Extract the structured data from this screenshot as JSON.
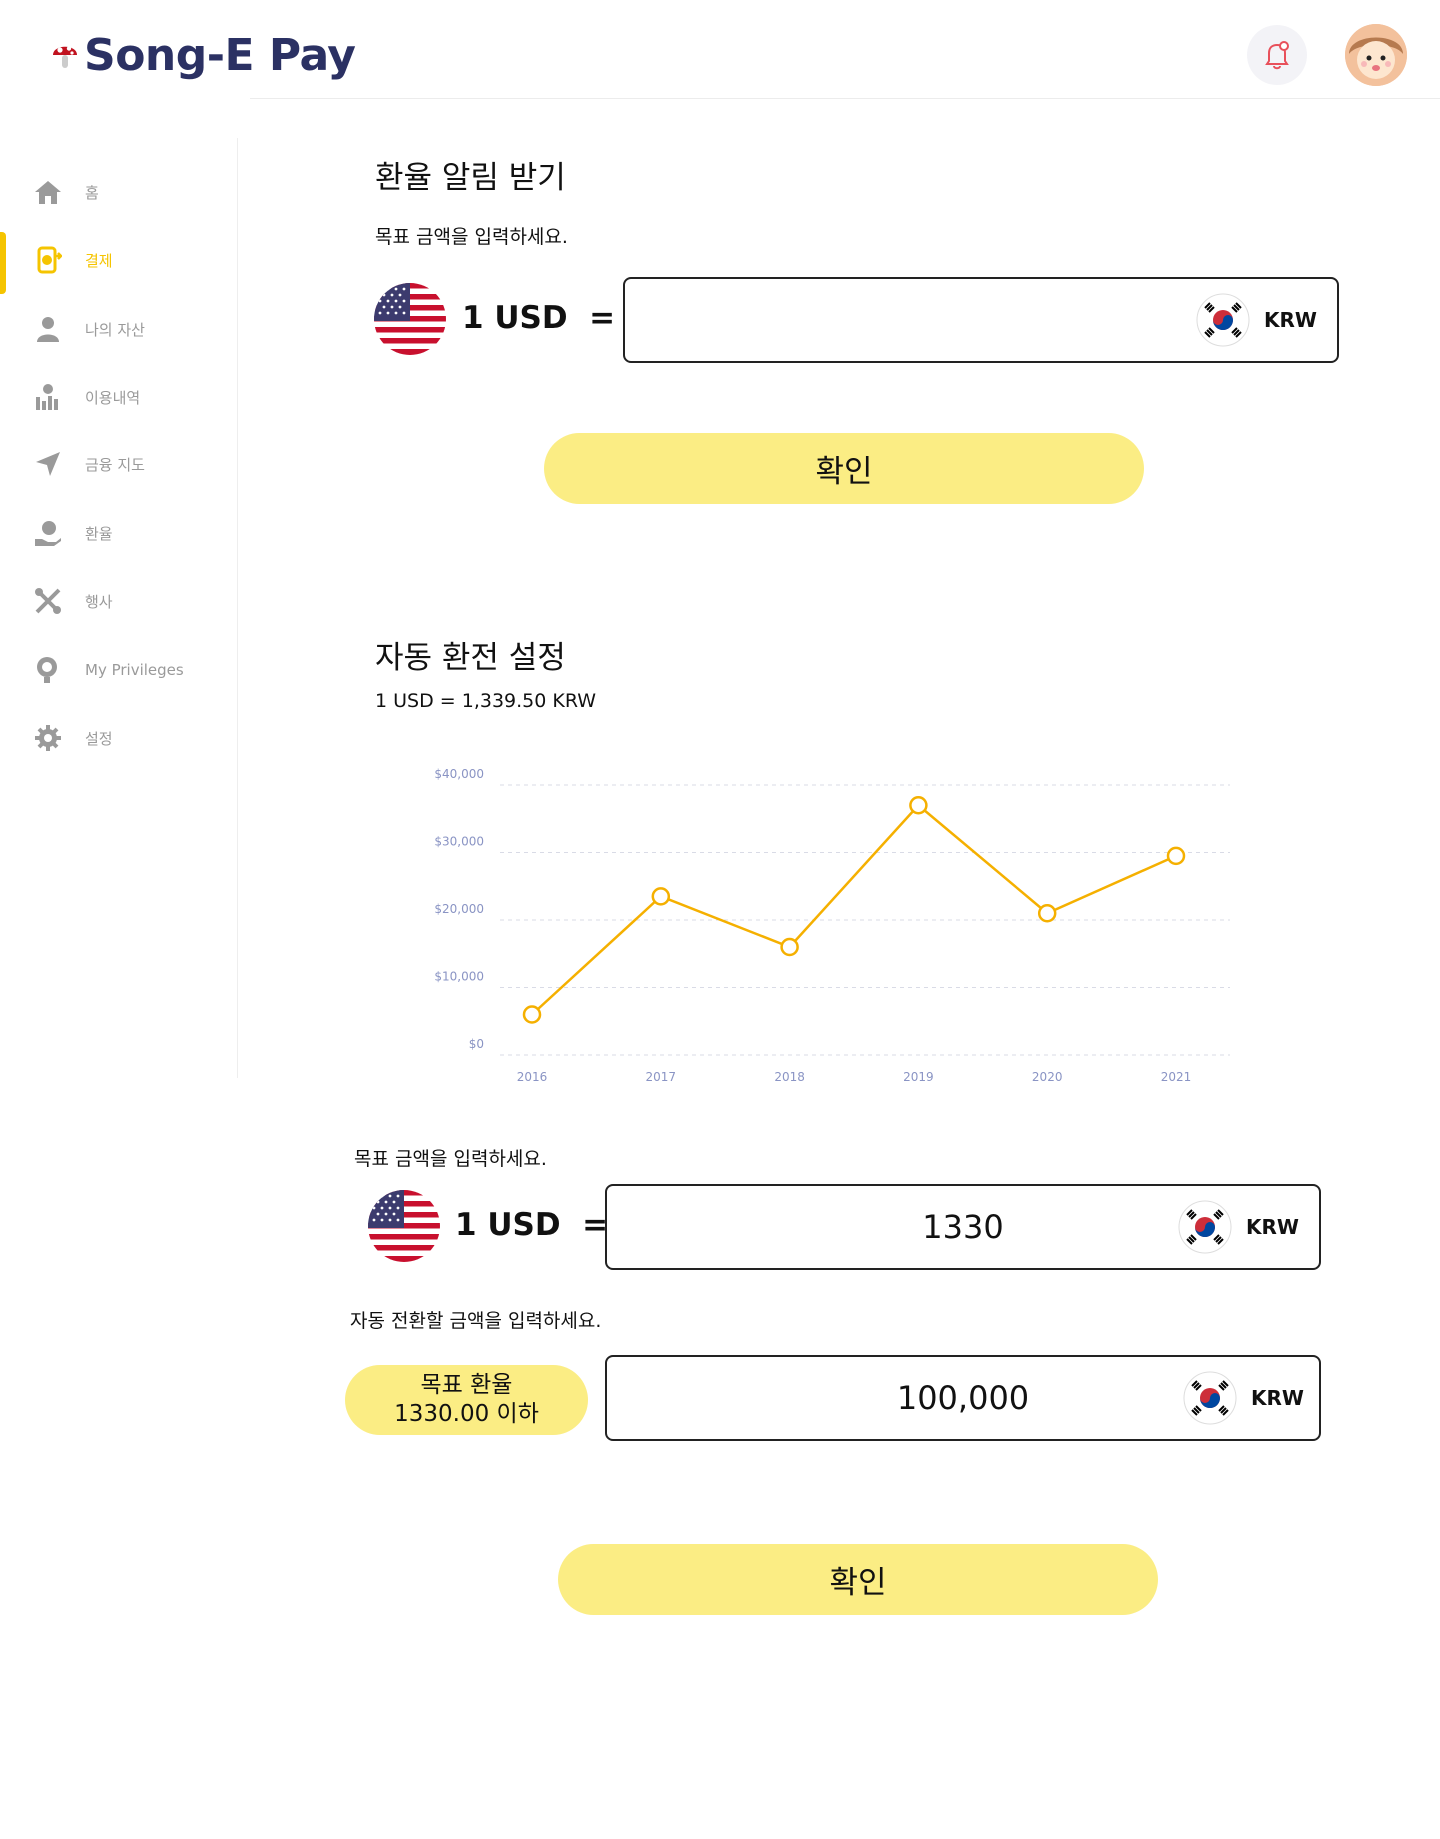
{
  "header": {
    "app_name": "Song-E Pay",
    "logo_icon": "mushroom-icon",
    "bell_icon": "bell-icon"
  },
  "sidebar": {
    "items": [
      {
        "label": "홈",
        "icon": "home-icon"
      },
      {
        "label": "결제",
        "icon": "payment-icon",
        "active": true
      },
      {
        "label": "나의 자산",
        "icon": "user-icon"
      },
      {
        "label": "이용내역",
        "icon": "history-icon"
      },
      {
        "label": "금융 지도",
        "icon": "map-arrow-icon"
      },
      {
        "label": "환율",
        "icon": "exchange-icon"
      },
      {
        "label": "행사",
        "icon": "event-tools-icon"
      },
      {
        "label": "My Privileges",
        "icon": "privilege-icon"
      },
      {
        "label": "설정",
        "icon": "gear-icon"
      }
    ]
  },
  "alert_section": {
    "title": "환율 알림 받기",
    "instruction": "목표 금액을 입력하세요.",
    "base_label": "1 USD  =",
    "target_value": "",
    "currency": "KRW",
    "confirm_label": "확인"
  },
  "auto_section": {
    "title": "자동 환전 설정",
    "current_rate": "1 USD = 1,339.50 KRW",
    "instruction": "목표 금액을 입력하세요.",
    "base_label": "1 USD  =",
    "target_value": "1330",
    "currency": "KRW",
    "amount_instruction": "자동 전환할 금액을 입력하세요.",
    "pill_line1": "목표 환율",
    "pill_line2": "1330.00 이하",
    "amount_value": "100,000",
    "amount_currency": "KRW",
    "confirm_label": "확인"
  },
  "colors": {
    "accent": "#f5c400",
    "button": "#fbed84",
    "line": "#f5b000",
    "brand_text": "#2b3163"
  },
  "chart_data": {
    "type": "line",
    "categories": [
      "2016",
      "2017",
      "2018",
      "2019",
      "2020",
      "2021"
    ],
    "series": [
      {
        "values": [
          6000,
          23500,
          16000,
          37000,
          21000,
          29500
        ]
      }
    ],
    "y_ticks": [
      "$0",
      "$10,000",
      "$20,000",
      "$30,000",
      "$40,000"
    ],
    "ylim": [
      0,
      40000
    ],
    "grid": true
  }
}
